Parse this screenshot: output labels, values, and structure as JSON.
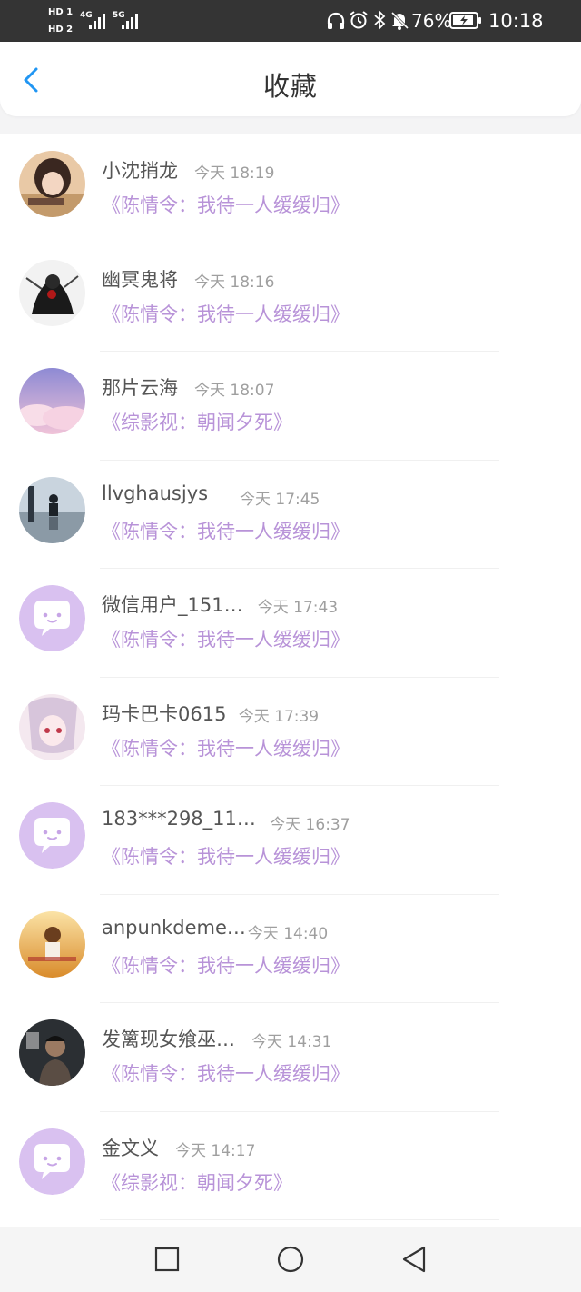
{
  "status_bar": {
    "hd1": "HD 1",
    "hd2": "HD 2",
    "net1": "4G",
    "net2": "5G",
    "battery": "76%",
    "time": "10:18"
  },
  "header": {
    "title": "收藏"
  },
  "items": [
    {
      "name": "小沈捎龙",
      "time": "今天 18:19",
      "book": "《陈情令：我待一人缓缓归》",
      "avatar": "photo-girl"
    },
    {
      "name": "幽冥鬼将",
      "time": "今天 18:16",
      "book": "《陈情令：我待一人缓缓归》",
      "avatar": "photo-dark-art"
    },
    {
      "name": "那片云海",
      "time": "今天 18:07",
      "book": "《综影视：朝闻夕死》",
      "avatar": "photo-clouds"
    },
    {
      "name": "llvghausjys",
      "time": "今天 17:45",
      "book": "《陈情令：我待一人缓缓归》",
      "avatar": "photo-silhouette"
    },
    {
      "name": "微信用户_151…",
      "time": "今天 17:43",
      "book": "《陈情令：我待一人缓缓归》",
      "avatar": "default"
    },
    {
      "name": "玛卡巴卡0615",
      "time": "今天 17:39",
      "book": "《陈情令：我待一人缓缓归》",
      "avatar": "photo-anime"
    },
    {
      "name": "183***298_11…",
      "time": "今天 16:37",
      "book": "《陈情令：我待一人缓缓归》",
      "avatar": "default"
    },
    {
      "name": "anpunkdeme…",
      "time": "今天 14:40",
      "book": "《陈情令：我待一人缓缓归》",
      "avatar": "photo-field"
    },
    {
      "name": "发篱现女飨巫…",
      "time": "今天 14:31",
      "book": "《陈情令：我待一人缓缓归》",
      "avatar": "photo-man"
    },
    {
      "name": "金文义",
      "time": "今天 14:17",
      "book": "《综影视：朝闻夕死》",
      "avatar": "default"
    }
  ]
}
